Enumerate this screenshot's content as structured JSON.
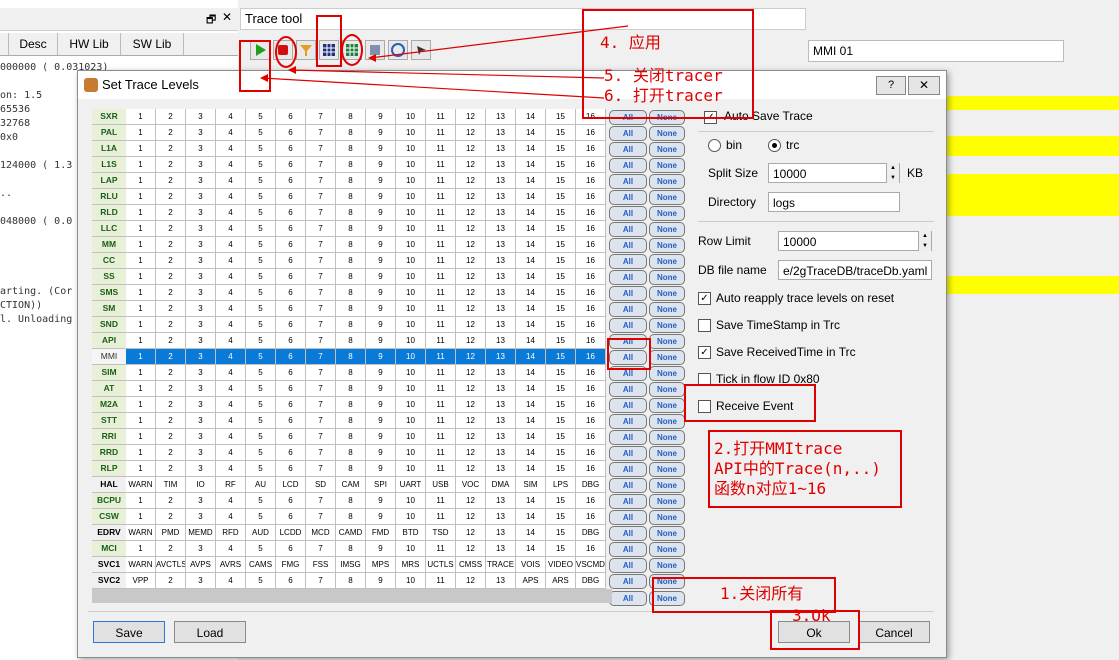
{
  "background": {
    "tabs": [
      "",
      "Desc",
      "HW Lib",
      "SW Lib"
    ],
    "log_lines": [
      "000000 ( 0.031023)",
      "",
      "on: 1.5",
      "65536",
      "32768",
      "0x0",
      "",
      "124000 ( 1.3",
      "",
      "..",
      "",
      "048000 ( 0.0",
      "",
      "",
      "",
      "",
      "arting. (Cor",
      "CTION))",
      "l. Unloading"
    ],
    "trace_tool_title": "Trace tool",
    "mmi_field": "MMI 01"
  },
  "dialog": {
    "title": "Set Trace Levels",
    "help": "?",
    "close": "✕",
    "grid": {
      "rows": [
        {
          "name": "SXR",
          "cells": [
            "1",
            "2",
            "3",
            "4",
            "5",
            "6",
            "7",
            "8",
            "9",
            "10",
            "11",
            "12",
            "13",
            "14",
            "15",
            "16"
          ]
        },
        {
          "name": "PAL",
          "cells": [
            "1",
            "2",
            "3",
            "4",
            "5",
            "6",
            "7",
            "8",
            "9",
            "10",
            "11",
            "12",
            "13",
            "14",
            "15",
            "16"
          ]
        },
        {
          "name": "L1A",
          "cells": [
            "1",
            "2",
            "3",
            "4",
            "5",
            "6",
            "7",
            "8",
            "9",
            "10",
            "11",
            "12",
            "13",
            "14",
            "15",
            "16"
          ]
        },
        {
          "name": "L1S",
          "cells": [
            "1",
            "2",
            "3",
            "4",
            "5",
            "6",
            "7",
            "8",
            "9",
            "10",
            "11",
            "12",
            "13",
            "14",
            "15",
            "16"
          ]
        },
        {
          "name": "LAP",
          "cells": [
            "1",
            "2",
            "3",
            "4",
            "5",
            "6",
            "7",
            "8",
            "9",
            "10",
            "11",
            "12",
            "13",
            "14",
            "15",
            "16"
          ]
        },
        {
          "name": "RLU",
          "cells": [
            "1",
            "2",
            "3",
            "4",
            "5",
            "6",
            "7",
            "8",
            "9",
            "10",
            "11",
            "12",
            "13",
            "14",
            "15",
            "16"
          ]
        },
        {
          "name": "RLD",
          "cells": [
            "1",
            "2",
            "3",
            "4",
            "5",
            "6",
            "7",
            "8",
            "9",
            "10",
            "11",
            "12",
            "13",
            "14",
            "15",
            "16"
          ]
        },
        {
          "name": "LLC",
          "cells": [
            "1",
            "2",
            "3",
            "4",
            "5",
            "6",
            "7",
            "8",
            "9",
            "10",
            "11",
            "12",
            "13",
            "14",
            "15",
            "16"
          ]
        },
        {
          "name": "MM",
          "cells": [
            "1",
            "2",
            "3",
            "4",
            "5",
            "6",
            "7",
            "8",
            "9",
            "10",
            "11",
            "12",
            "13",
            "14",
            "15",
            "16"
          ]
        },
        {
          "name": "CC",
          "cells": [
            "1",
            "2",
            "3",
            "4",
            "5",
            "6",
            "7",
            "8",
            "9",
            "10",
            "11",
            "12",
            "13",
            "14",
            "15",
            "16"
          ]
        },
        {
          "name": "SS",
          "cells": [
            "1",
            "2",
            "3",
            "4",
            "5",
            "6",
            "7",
            "8",
            "9",
            "10",
            "11",
            "12",
            "13",
            "14",
            "15",
            "16"
          ]
        },
        {
          "name": "SMS",
          "cells": [
            "1",
            "2",
            "3",
            "4",
            "5",
            "6",
            "7",
            "8",
            "9",
            "10",
            "11",
            "12",
            "13",
            "14",
            "15",
            "16"
          ]
        },
        {
          "name": "SM",
          "cells": [
            "1",
            "2",
            "3",
            "4",
            "5",
            "6",
            "7",
            "8",
            "9",
            "10",
            "11",
            "12",
            "13",
            "14",
            "15",
            "16"
          ]
        },
        {
          "name": "SND",
          "cells": [
            "1",
            "2",
            "3",
            "4",
            "5",
            "6",
            "7",
            "8",
            "9",
            "10",
            "11",
            "12",
            "13",
            "14",
            "15",
            "16"
          ]
        },
        {
          "name": "API",
          "cells": [
            "1",
            "2",
            "3",
            "4",
            "5",
            "6",
            "7",
            "8",
            "9",
            "10",
            "11",
            "12",
            "13",
            "14",
            "15",
            "16"
          ]
        },
        {
          "name": "MMI",
          "cells": [
            "1",
            "2",
            "3",
            "4",
            "5",
            "6",
            "7",
            "8",
            "9",
            "10",
            "11",
            "12",
            "13",
            "14",
            "15",
            "16"
          ],
          "selected": true
        },
        {
          "name": "SIM",
          "cells": [
            "1",
            "2",
            "3",
            "4",
            "5",
            "6",
            "7",
            "8",
            "9",
            "10",
            "11",
            "12",
            "13",
            "14",
            "15",
            "16"
          ]
        },
        {
          "name": "AT",
          "cells": [
            "1",
            "2",
            "3",
            "4",
            "5",
            "6",
            "7",
            "8",
            "9",
            "10",
            "11",
            "12",
            "13",
            "14",
            "15",
            "16"
          ]
        },
        {
          "name": "M2A",
          "cells": [
            "1",
            "2",
            "3",
            "4",
            "5",
            "6",
            "7",
            "8",
            "9",
            "10",
            "11",
            "12",
            "13",
            "14",
            "15",
            "16"
          ]
        },
        {
          "name": "STT",
          "cells": [
            "1",
            "2",
            "3",
            "4",
            "5",
            "6",
            "7",
            "8",
            "9",
            "10",
            "11",
            "12",
            "13",
            "14",
            "15",
            "16"
          ]
        },
        {
          "name": "RRI",
          "cells": [
            "1",
            "2",
            "3",
            "4",
            "5",
            "6",
            "7",
            "8",
            "9",
            "10",
            "11",
            "12",
            "13",
            "14",
            "15",
            "16"
          ]
        },
        {
          "name": "RRD",
          "cells": [
            "1",
            "2",
            "3",
            "4",
            "5",
            "6",
            "7",
            "8",
            "9",
            "10",
            "11",
            "12",
            "13",
            "14",
            "15",
            "16"
          ]
        },
        {
          "name": "RLP",
          "cells": [
            "1",
            "2",
            "3",
            "4",
            "5",
            "6",
            "7",
            "8",
            "9",
            "10",
            "11",
            "12",
            "13",
            "14",
            "15",
            "16"
          ]
        },
        {
          "name": "HAL",
          "cells": [
            "WARN",
            "TIM",
            "IO",
            "RF",
            "AU",
            "LCD",
            "SD",
            "CAM",
            "SPI",
            "UART",
            "USB",
            "VOC",
            "DMA",
            "SIM",
            "LPS",
            "DBG"
          ]
        },
        {
          "name": "BCPU",
          "cells": [
            "1",
            "2",
            "3",
            "4",
            "5",
            "6",
            "7",
            "8",
            "9",
            "10",
            "11",
            "12",
            "13",
            "14",
            "15",
            "16"
          ]
        },
        {
          "name": "CSW",
          "cells": [
            "1",
            "2",
            "3",
            "4",
            "5",
            "6",
            "7",
            "8",
            "9",
            "10",
            "11",
            "12",
            "13",
            "14",
            "15",
            "16"
          ]
        },
        {
          "name": "EDRV",
          "cells": [
            "WARN",
            "PMD",
            "MEMD",
            "RFD",
            "AUD",
            "LCDD",
            "MCD",
            "CAMD",
            "FMD",
            "BTD",
            "TSD",
            "12",
            "13",
            "14",
            "15",
            "DBG"
          ]
        },
        {
          "name": "MCI",
          "cells": [
            "1",
            "2",
            "3",
            "4",
            "5",
            "6",
            "7",
            "8",
            "9",
            "10",
            "11",
            "12",
            "13",
            "14",
            "15",
            "16"
          ]
        },
        {
          "name": "SVC1",
          "cells": [
            "WARN",
            "AVCTLS",
            "AVPS",
            "AVRS",
            "CAMS",
            "FMG",
            "FSS",
            "IMSG",
            "MPS",
            "MRS",
            "UCTLS",
            "CMSS",
            "TRACE",
            "VOIS",
            "VIDEO",
            "VSCMD"
          ]
        },
        {
          "name": "SVC2",
          "cells": [
            "VPP",
            "2",
            "3",
            "4",
            "5",
            "6",
            "7",
            "8",
            "9",
            "10",
            "11",
            "12",
            "13",
            "APS",
            "ARS",
            "DBG"
          ]
        }
      ],
      "all_label": "All",
      "none_label": "None"
    },
    "right": {
      "auto_save_trace": {
        "label": "Auto Save Trace",
        "checked": true
      },
      "format_bin": "bin",
      "format_trc": "trc",
      "split_size_label": "Split Size",
      "split_size_value": "10000",
      "split_size_unit": "KB",
      "directory_label": "Directory",
      "directory_value": "logs",
      "row_limit_label": "Row Limit",
      "row_limit_value": "10000",
      "db_file_label": "DB file name",
      "db_file_value": "e/2gTraceDB/traceDb.yaml",
      "auto_reapply": {
        "label": "Auto reapply trace levels on reset",
        "checked": true
      },
      "save_timestamp": {
        "label": "Save TimeStamp in Trc",
        "checked": false
      },
      "save_received": {
        "label": "Save ReceivedTime in Trc",
        "checked": true
      },
      "tick_flow": {
        "label": "Tick in flow ID 0x80",
        "checked": false
      },
      "receive_event": {
        "label": "Receive Event",
        "checked": false
      }
    },
    "buttons": {
      "save": "Save",
      "load": "Load",
      "ok": "Ok",
      "cancel": "Cancel"
    }
  },
  "annotations": {
    "a4": "4. 应用",
    "a5": "5. 关闭tracer",
    "a6": "6. 打开tracer",
    "a2_line1": "2.打开MMItrace",
    "a2_line2": "API中的Trace(n,..)",
    "a2_line3": "函数n对应1~16",
    "a1": "1.关闭所有",
    "a3": "3.Ok"
  },
  "colors": {
    "accent_red": "#e00000",
    "selection_blue": "#0a7ad8",
    "highlight_yellow": "#ffff00"
  }
}
